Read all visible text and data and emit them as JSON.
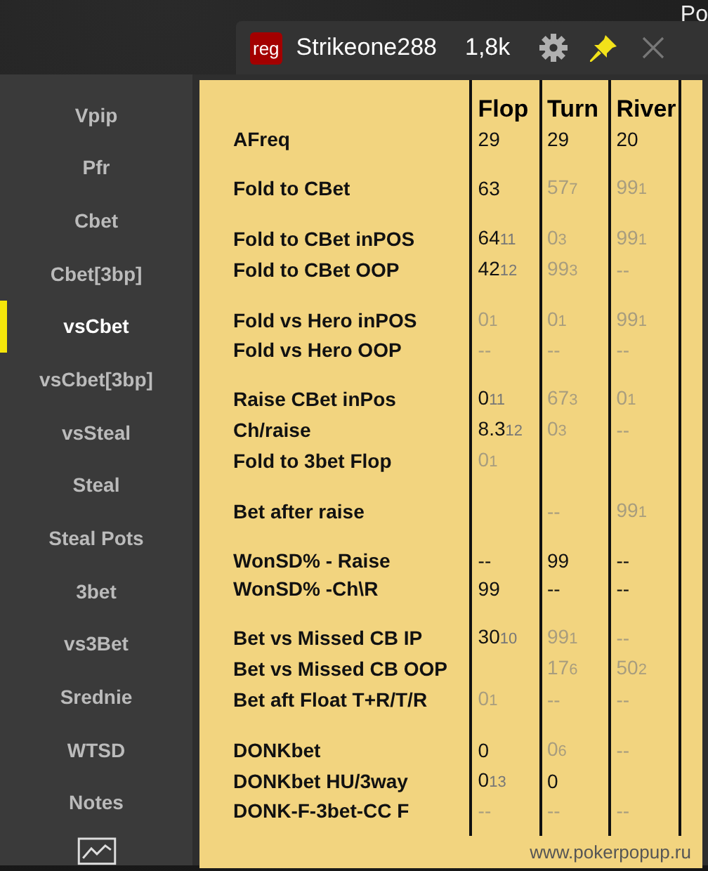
{
  "background_text": "Po",
  "header": {
    "badge": "reg",
    "player": "Strikeone288",
    "hands": "1,8k"
  },
  "sidebar": {
    "items": [
      {
        "label": "Vpip",
        "selected": false
      },
      {
        "label": "Pfr",
        "selected": false
      },
      {
        "label": "Cbet",
        "selected": false
      },
      {
        "label": "Cbet[3bp]",
        "selected": false
      },
      {
        "label": "vsCbet",
        "selected": true
      },
      {
        "label": "vsCbet[3bp]",
        "selected": false
      },
      {
        "label": "vsSteal",
        "selected": false
      },
      {
        "label": "Steal",
        "selected": false
      },
      {
        "label": "Steal Pots",
        "selected": false
      },
      {
        "label": "3bet",
        "selected": false
      },
      {
        "label": "vs3Bet",
        "selected": false
      },
      {
        "label": "Srednie",
        "selected": false
      },
      {
        "label": "WTSD",
        "selected": false
      },
      {
        "label": "Notes",
        "selected": false
      }
    ]
  },
  "table": {
    "columns": [
      "Flop",
      "Turn",
      "River"
    ],
    "groups": [
      [
        {
          "label": "AFreq",
          "cells": [
            {
              "value": "29",
              "dim": false
            },
            {
              "value": "29",
              "dim": false
            },
            {
              "value": "20",
              "dim": false
            }
          ]
        }
      ],
      [
        {
          "label": "Fold to CBet",
          "cells": [
            {
              "value": "63",
              "dim": false
            },
            {
              "value": "57",
              "sample": "7",
              "dim": true
            },
            {
              "value": "99",
              "sample": "1",
              "dim": true
            }
          ]
        }
      ],
      [
        {
          "label": "Fold to CBet inPOS",
          "cells": [
            {
              "value": "64",
              "sample": "11",
              "dim": false
            },
            {
              "value": "0",
              "sample": "3",
              "dim": true
            },
            {
              "value": "99",
              "sample": "1",
              "dim": true
            }
          ]
        },
        {
          "label": "Fold to CBet OOP",
          "cells": [
            {
              "value": "42",
              "sample": "12",
              "dim": false
            },
            {
              "value": "99",
              "sample": "3",
              "dim": true
            },
            {
              "value": "--",
              "dim": true
            }
          ]
        }
      ],
      [
        {
          "label": "Fold vs Hero inPOS",
          "cells": [
            {
              "value": "0",
              "sample": "1",
              "dim": true
            },
            {
              "value": "0",
              "sample": "1",
              "dim": true
            },
            {
              "value": "99",
              "sample": "1",
              "dim": true
            }
          ]
        },
        {
          "label": "Fold vs Hero OOP",
          "cells": [
            {
              "value": "--",
              "dim": true
            },
            {
              "value": "--",
              "dim": true
            },
            {
              "value": "--",
              "dim": true
            }
          ]
        }
      ],
      [
        {
          "label": "Raise CBet inPos",
          "cells": [
            {
              "value": "0",
              "sample": "11",
              "dim": false
            },
            {
              "value": "67",
              "sample": "3",
              "dim": true
            },
            {
              "value": "0",
              "sample": "1",
              "dim": true
            }
          ]
        },
        {
          "label": "Ch/raise",
          "cells": [
            {
              "value": "8.3",
              "sample": "12",
              "dim": false
            },
            {
              "value": "0",
              "sample": "3",
              "dim": true
            },
            {
              "value": "--",
              "dim": true
            }
          ]
        },
        {
          "label": "Fold to 3bet Flop",
          "cells": [
            {
              "value": "0",
              "sample": "1",
              "dim": true
            },
            null,
            null
          ]
        }
      ],
      [
        {
          "label": "Bet after raise",
          "cells": [
            null,
            {
              "value": "--",
              "dim": true
            },
            {
              "value": "99",
              "sample": "1",
              "dim": true
            }
          ]
        }
      ],
      [
        {
          "label": "WonSD% - Raise",
          "cells": [
            {
              "value": "--",
              "dim": false
            },
            {
              "value": "99",
              "dim": false
            },
            {
              "value": "--",
              "dim": false
            }
          ]
        },
        {
          "label": "WonSD% -Ch\\R",
          "cells": [
            {
              "value": "99",
              "dim": false
            },
            {
              "value": "--",
              "dim": false
            },
            {
              "value": "--",
              "dim": false
            }
          ]
        }
      ],
      [
        {
          "label": "Bet vs Missed CB IP",
          "cells": [
            {
              "value": "30",
              "sample": "10",
              "dim": false
            },
            {
              "value": "99",
              "sample": "1",
              "dim": true
            },
            {
              "value": "--",
              "dim": true
            }
          ]
        },
        {
          "label": "Bet vs Missed CB OOP",
          "cells": [
            null,
            {
              "value": "17",
              "sample": "6",
              "dim": true
            },
            {
              "value": "50",
              "sample": "2",
              "dim": true
            }
          ]
        },
        {
          "label": "Bet aft Float T+R/T/R",
          "cells": [
            {
              "value": "0",
              "sample": "1",
              "dim": true
            },
            {
              "value": "--",
              "dim": true
            },
            {
              "value": "--",
              "dim": true
            }
          ]
        }
      ],
      [
        {
          "label": "DONKbet",
          "cells": [
            {
              "value": "0",
              "dim": false
            },
            {
              "value": "0",
              "sample": "6",
              "dim": true
            },
            {
              "value": "--",
              "dim": true
            }
          ]
        },
        {
          "label": "DONKbet HU/3way",
          "cells": [
            {
              "value": "0",
              "sample": "13",
              "dim": false
            },
            {
              "value": "0",
              "dim": false
            },
            null
          ]
        },
        {
          "label": "DONK-F-3bet-CC F",
          "cells": [
            {
              "value": "--",
              "dim": true
            },
            {
              "value": "--",
              "dim": true
            },
            {
              "value": "--",
              "dim": true
            }
          ]
        }
      ]
    ]
  },
  "footer": "www.pokerpopup.ru"
}
